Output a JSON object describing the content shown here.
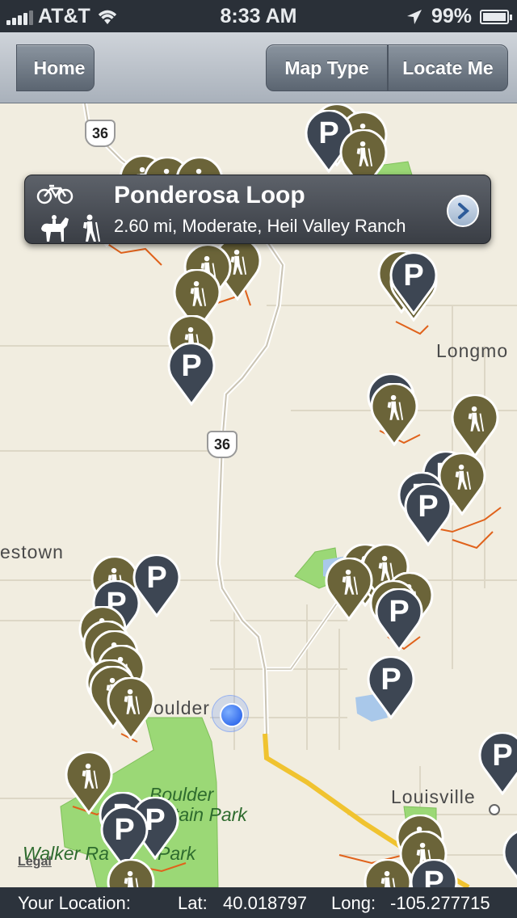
{
  "status_bar": {
    "carrier": "AT&T",
    "time": "8:33 AM",
    "battery": "99%",
    "battery_level": 0.99
  },
  "nav_bar": {
    "back_label": "Home",
    "map_type_label": "Map Type",
    "locate_me_label": "Locate Me"
  },
  "map": {
    "labels": {
      "longmont": "Longmo",
      "jamestown": "estown",
      "boulder": "oulder",
      "louisville": "Louisville",
      "park_1": "Boulder",
      "park_2": "tain Park",
      "park_3": "Walker Ra",
      "park_4": "Park",
      "legal": "Legal"
    },
    "shields": [
      "36",
      "36"
    ],
    "pin_glyph_parking": "P"
  },
  "callout": {
    "title": "Ponderosa Loop",
    "subtitle": "2.60 mi, Moderate, Heil Valley Ranch",
    "icons": [
      "bike-icon",
      "horse-icon",
      "hiker-icon"
    ]
  },
  "bottom_bar": {
    "your_location_label": "Your Location:",
    "lat_label": "Lat:",
    "lat_value": "40.018797",
    "long_label": "Long:",
    "long_value": "-105.277715"
  },
  "colors": {
    "trail_pin": "#6b6439",
    "parking_pin": "#3d4653",
    "park_green": "#8fd46a",
    "water": "#a9c8ea",
    "trail_line": "#e0621b",
    "highway": "#f0c330"
  }
}
